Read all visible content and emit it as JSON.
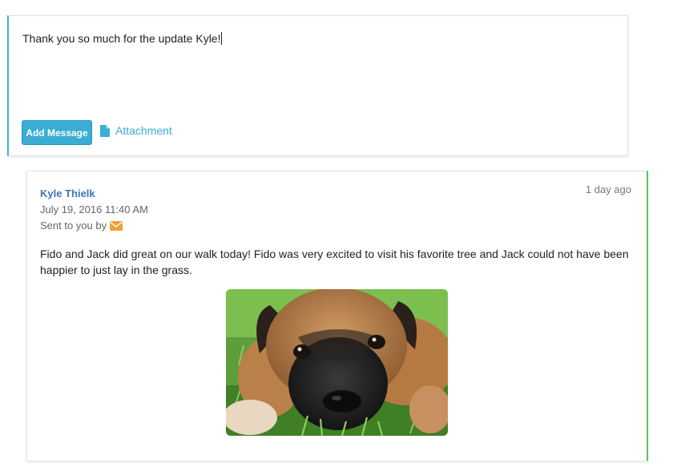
{
  "composer": {
    "text": "Thank you so much for the update Kyle!",
    "add_button": "Add Message",
    "attachment_label": "Attachment",
    "accent_color": "#3fb2d6"
  },
  "message": {
    "author": "Kyle Thielk",
    "time_ago": "1 day ago",
    "date": "July 19, 2016 11:40 AM",
    "sent_via": "Sent to you by",
    "sent_via_icon": "envelope-icon",
    "body": "Fido and Jack did great on our walk today! Fido was very excited to visit his favorite tree and Jack could not have been happier to just lay in the grass.",
    "photo_icon": "puppy-photo",
    "accent_color": "#5cc35a"
  }
}
